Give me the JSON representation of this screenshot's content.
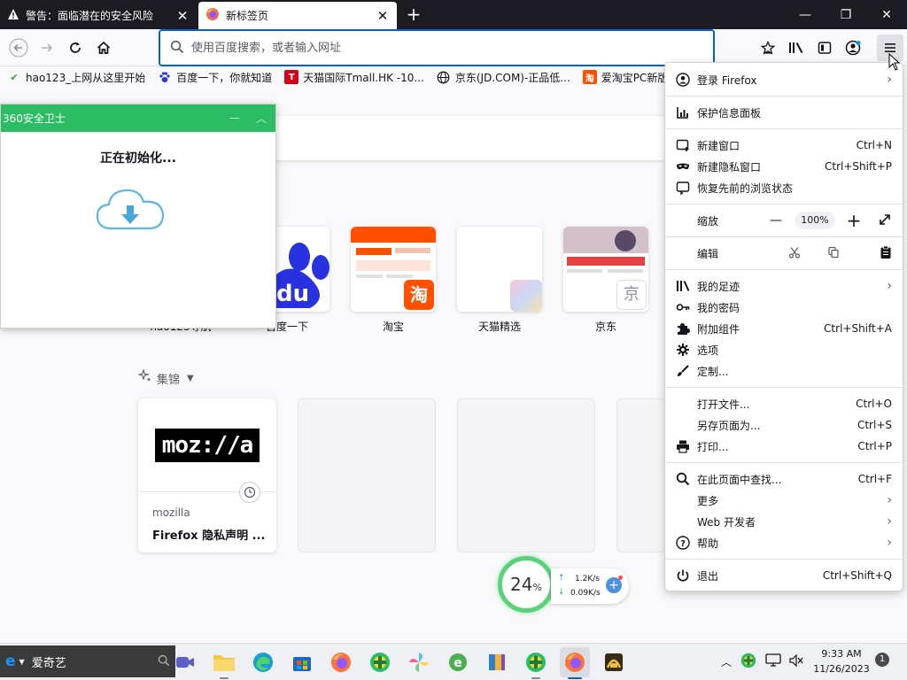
{
  "window": {
    "tabs": [
      {
        "label": "警告：面临潜在的安全风险",
        "active": false
      },
      {
        "label": "新标签页",
        "active": true
      }
    ],
    "controls": {
      "minimize": "—",
      "maximize": "❐",
      "close": "✕"
    }
  },
  "navbar": {
    "url_placeholder": "使用百度搜索，或者输入网址"
  },
  "bookmarks": [
    {
      "label": "hao123_上网从这里开始",
      "icon": "hao123-icon",
      "color": "#3aa138"
    },
    {
      "label": "百度一下，你就知道",
      "icon": "baidu-icon",
      "color": "#2932e1"
    },
    {
      "label": "天猫国际Tmall.HK -10...",
      "icon": "tmall-icon",
      "color": "#d8001b"
    },
    {
      "label": "京东(JD.COM)-正品低...",
      "icon": "globe-icon",
      "color": "#5b5b66"
    },
    {
      "label": "爱淘宝PC新版",
      "icon": "taobao-icon",
      "color": "#ff5000"
    }
  ],
  "popup360": {
    "title": "360安全卫士",
    "status": "正在初始化..."
  },
  "topsites": [
    {
      "label": "hao123导航",
      "icon": "hao123-icon"
    },
    {
      "label": "百度一下",
      "icon": "baidu-icon"
    },
    {
      "label": "淘宝",
      "icon": "taobao-icon"
    },
    {
      "label": "天猫精选",
      "icon": "tmall-icon"
    },
    {
      "label": "京东",
      "icon": "jd-icon",
      "badge": "京"
    }
  ],
  "collections": {
    "heading": "集锦",
    "card": {
      "logo": "moz://a",
      "source": "mozilla",
      "title": "Firefox 隐私声明 ..."
    }
  },
  "speed_widget": {
    "percent": "24",
    "percent_unit": "%",
    "upload": "1.2K/s",
    "download": "0.09K/s"
  },
  "app_menu": {
    "items": [
      {
        "label": "登录 Firefox",
        "icon": "account-icon",
        "arrow": true
      },
      {
        "label": "保护信息面板",
        "icon": "chart-icon"
      },
      {
        "label": "新建窗口",
        "icon": "new-window-icon",
        "key": "Ctrl+N"
      },
      {
        "label": "新建隐私窗口",
        "icon": "private-mask-icon",
        "key": "Ctrl+Shift+P"
      },
      {
        "label": "恢复先前的浏览状态",
        "icon": "restore-session-icon"
      },
      {
        "label": "我的足迹",
        "icon": "library-icon",
        "arrow": true
      },
      {
        "label": "我的密码",
        "icon": "key-icon"
      },
      {
        "label": "附加组件",
        "icon": "puzzle-icon",
        "key": "Ctrl+Shift+A"
      },
      {
        "label": "选项",
        "icon": "gear-icon"
      },
      {
        "label": "定制...",
        "icon": "brush-icon"
      },
      {
        "label": "打开文件...",
        "key": "Ctrl+O"
      },
      {
        "label": "另存页面为...",
        "key": "Ctrl+S"
      },
      {
        "label": "打印...",
        "icon": "print-icon",
        "key": "Ctrl+P"
      },
      {
        "label": "在此页面中查找...",
        "icon": "search-icon",
        "key": "Ctrl+F"
      },
      {
        "label": "更多",
        "arrow": true
      },
      {
        "label": "Web 开发者",
        "arrow": true
      },
      {
        "label": "帮助",
        "icon": "help-icon",
        "arrow": true
      },
      {
        "label": "退出",
        "icon": "power-icon",
        "key": "Ctrl+Shift+Q"
      }
    ],
    "zoom": {
      "label": "缩放",
      "minus": "—",
      "value": "100%",
      "plus": "+"
    },
    "edit": {
      "label": "编辑"
    }
  },
  "taskbar": {
    "search_text": "爱奇艺",
    "time": "9:33 AM",
    "date": "11/26/2023",
    "notification_count": "1"
  }
}
